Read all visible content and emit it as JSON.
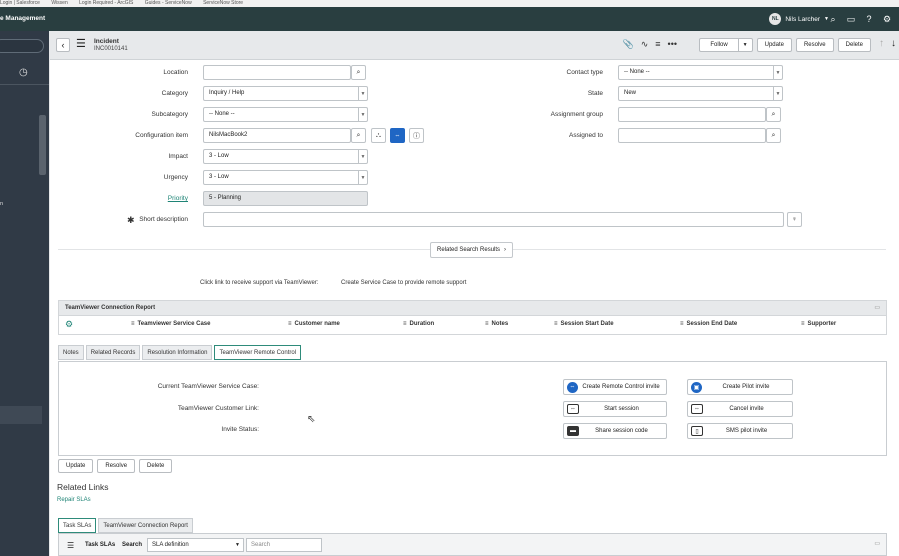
{
  "browser_bar": [
    "Login | Salesforce",
    "Wissen",
    "Login Required - ArcGIS",
    "Guides - ServiceNow",
    "ServiceNow Store"
  ],
  "topbar": {
    "brand": "e Management",
    "user_initials": "NL",
    "user_name": "Nils Larcher",
    "icons": [
      "search-icon",
      "chat-icon",
      "help-icon",
      "gear-icon"
    ]
  },
  "nav": {
    "partial_item": "n"
  },
  "record": {
    "type": "Incident",
    "number": "INC0010141",
    "header_icons": [
      "attachment-icon",
      "activity-icon",
      "settings-icon",
      "more-icon"
    ],
    "buttons": {
      "follow": "Follow",
      "update": "Update",
      "resolve": "Resolve",
      "delete": "Delete"
    }
  },
  "form": {
    "location": {
      "label": "Location",
      "value": ""
    },
    "category": {
      "label": "Category",
      "value": "Inquiry / Help"
    },
    "subcategory": {
      "label": "Subcategory",
      "value": "-- None --"
    },
    "ci": {
      "label": "Configuration item",
      "value": "NilsMacBook2"
    },
    "impact": {
      "label": "Impact",
      "value": "3 - Low"
    },
    "urgency": {
      "label": "Urgency",
      "value": "3 - Low"
    },
    "priority": {
      "label": "Priority",
      "value": "5 - Planning"
    },
    "short_description": {
      "label": "Short description",
      "value": ""
    },
    "contact_type": {
      "label": "Contact type",
      "value": "-- None --"
    },
    "state": {
      "label": "State",
      "value": "New"
    },
    "assignment_group": {
      "label": "Assignment group",
      "value": ""
    },
    "assigned_to": {
      "label": "Assigned to",
      "value": ""
    }
  },
  "related_search": "Related Search Results",
  "tv_links": {
    "receive": "Click link to receive support via TeamViewer:",
    "create": "Create Service Case to provide remote support"
  },
  "tv_report": {
    "title": "TeamViewer Connection Report",
    "columns": [
      "Teamviewer Service Case",
      "Customer name",
      "Duration",
      "Notes",
      "Session Start Date",
      "Session End Date",
      "Supporter"
    ]
  },
  "tabs": [
    "Notes",
    "Related Records",
    "Resolution Information",
    "TeamViewer Remote Control"
  ],
  "tv_panel": {
    "labels": [
      "Current TeamViewer Service Case:",
      "TeamViewer Customer Link:",
      "Invite Status:"
    ],
    "buttons": [
      "Create Remote Control invite",
      "Create Pilot invite",
      "Start session",
      "Cancel invite",
      "Share session code",
      "SMS pilot invite"
    ]
  },
  "bottom_buttons": [
    "Update",
    "Resolve",
    "Delete"
  ],
  "related_links": {
    "heading": "Related Links",
    "repair": "Repair SLAs"
  },
  "lower_tabs": [
    "Task SLAs",
    "TeamViewer Connection Report"
  ],
  "sla_list": {
    "title": "Task SLAs",
    "search_label": "Search",
    "field": "SLA definition",
    "placeholder": "Search"
  }
}
